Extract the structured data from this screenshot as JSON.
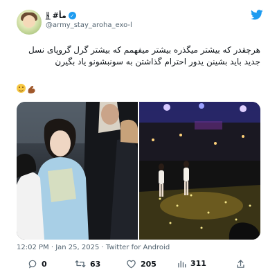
{
  "author": {
    "display_name": "#مأ",
    "display_name_prefix": "ᚺ̲",
    "handle": "@army_stay_aroha_exo-l"
  },
  "tweet": {
    "text": "هرچقدر که بیشتر میگذره بیشتر میفهمم که بیشتر گرل گروپای نسل جدید باید بشینن یدور احترام گذاشتن به سونبشونو یاد بگیرن",
    "emojis": [
      "slightly-smiling-face",
      "flexed-biceps"
    ]
  },
  "meta": {
    "time": "12:02 PM",
    "separator": " · ",
    "date": "Jan 25, 2025",
    "source": "Twitter for Android"
  },
  "actions": {
    "replies": "0",
    "retweets": "63",
    "likes": "205",
    "views": "311"
  },
  "colors": {
    "brand": "#1d9bf0",
    "text": "#0f1419",
    "secondary": "#536471"
  }
}
